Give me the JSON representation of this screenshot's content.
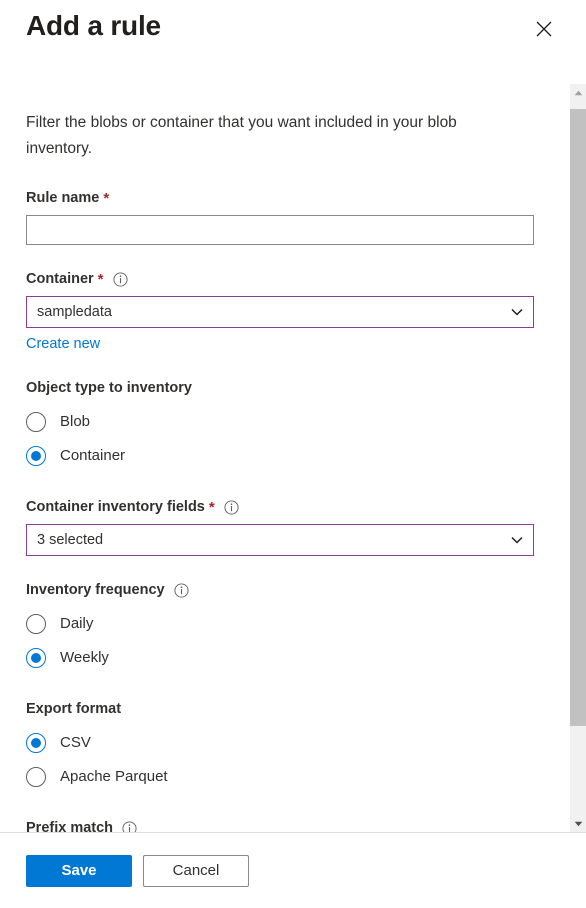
{
  "header": {
    "title": "Add a rule",
    "close_icon": "close-icon"
  },
  "body": {
    "intro": "Filter the blobs or container that you want included in your blob inventory."
  },
  "fields": {
    "rule_name": {
      "label": "Rule name",
      "required_mark": "*",
      "value": "",
      "placeholder": ""
    },
    "container": {
      "label": "Container",
      "required_mark": "*",
      "info_icon": "info-icon",
      "value": "sampledata",
      "chevron_icon": "chevron-down-icon",
      "create_new_link": "Create new"
    },
    "object_type": {
      "label": "Object type to inventory",
      "options": [
        {
          "label": "Blob",
          "selected": false
        },
        {
          "label": "Container",
          "selected": true
        }
      ]
    },
    "inventory_fields": {
      "label": "Container inventory fields",
      "required_mark": "*",
      "info_icon": "info-icon",
      "value": "3 selected",
      "chevron_icon": "chevron-down-icon"
    },
    "frequency": {
      "label": "Inventory frequency",
      "info_icon": "info-icon",
      "options": [
        {
          "label": "Daily",
          "selected": false
        },
        {
          "label": "Weekly",
          "selected": true
        }
      ]
    },
    "export_format": {
      "label": "Export format",
      "options": [
        {
          "label": "CSV",
          "selected": true
        },
        {
          "label": "Apache Parquet",
          "selected": false
        }
      ]
    },
    "prefix_match": {
      "label": "Prefix match",
      "info_icon": "info-icon"
    }
  },
  "scrollbar": {
    "up_icon": "scroll-up-arrow-icon",
    "down_icon": "scroll-down-arrow-icon"
  },
  "footer": {
    "save_label": "Save",
    "cancel_label": "Cancel"
  },
  "colors": {
    "accent": "#0078d4",
    "required": "#a4262c",
    "focus_border": "#8a3f91",
    "link": "#0078d4"
  }
}
